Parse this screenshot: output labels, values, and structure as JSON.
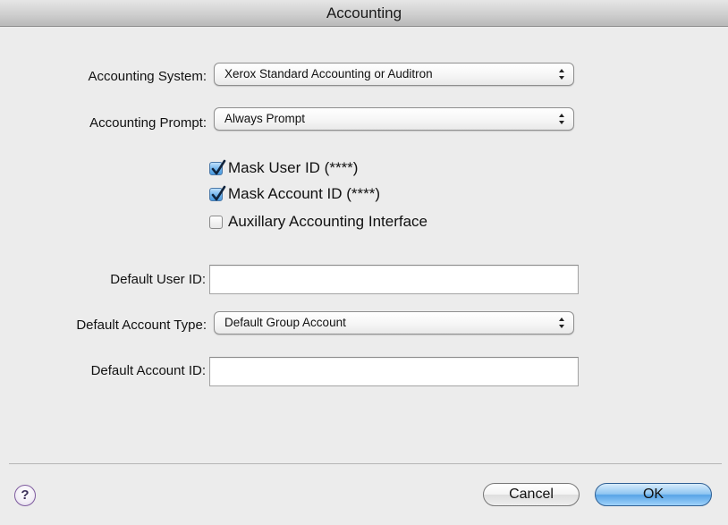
{
  "window": {
    "title": "Accounting"
  },
  "accounting_system": {
    "label": "Accounting System:",
    "value": "Xerox Standard Accounting or Auditron"
  },
  "accounting_prompt": {
    "label": "Accounting Prompt:",
    "value": "Always Prompt"
  },
  "options": {
    "mask_user_id": {
      "label": "Mask User ID (****)",
      "checked": true
    },
    "mask_account_id": {
      "label": "Mask Account ID (****)",
      "checked": true
    },
    "auxiliary_interface": {
      "label": "Auxillary Accounting Interface",
      "checked": false
    }
  },
  "default_user_id": {
    "label": "Default User ID:",
    "value": ""
  },
  "default_account_type": {
    "label": "Default Account Type:",
    "value": "Default Group Account"
  },
  "default_account_id": {
    "label": "Default Account ID:",
    "value": ""
  },
  "footer": {
    "help_glyph": "?",
    "cancel_label": "Cancel",
    "ok_label": "OK"
  },
  "colors": {
    "window_bg": "#ececec",
    "default_button": "#57a4e6",
    "checkbox_checked": "#6fb3ec"
  }
}
